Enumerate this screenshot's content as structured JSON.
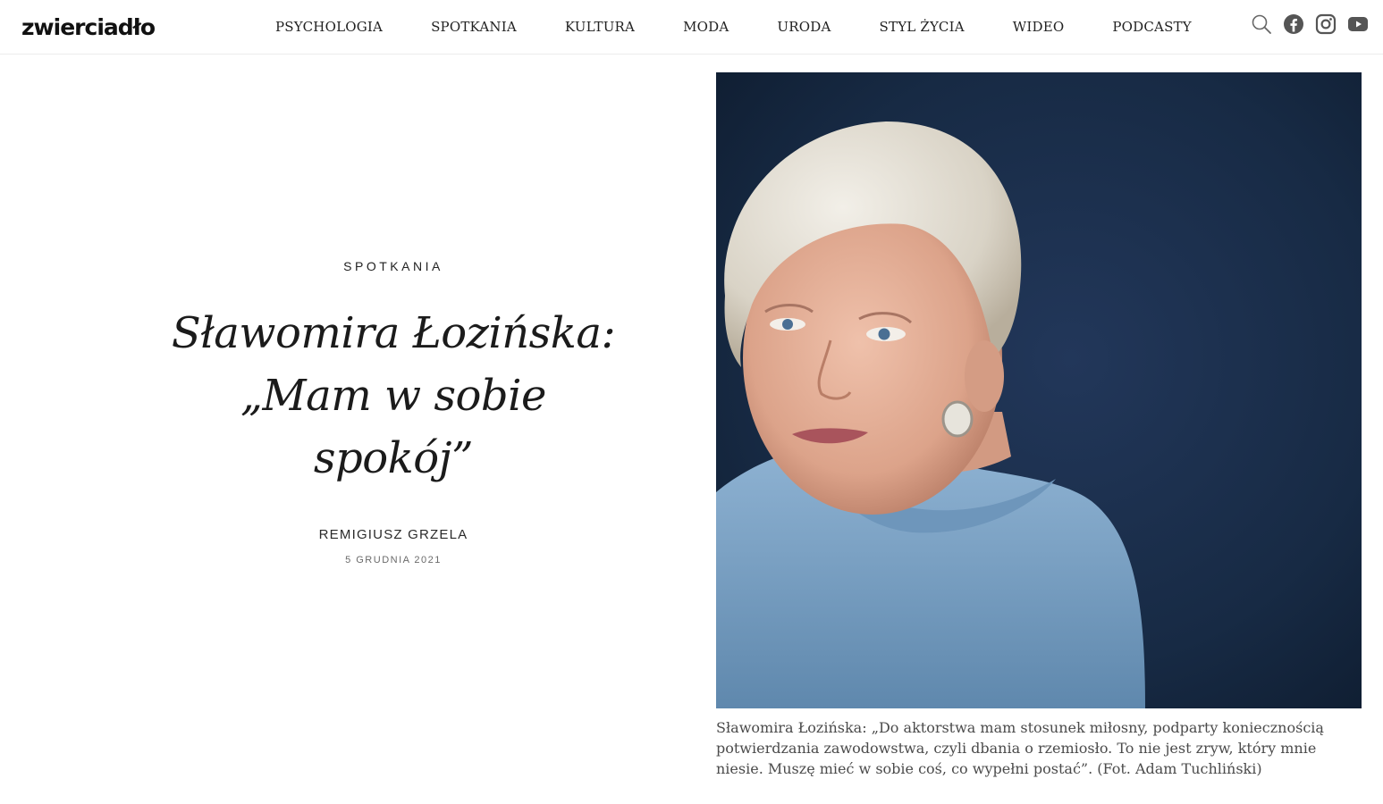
{
  "site": {
    "logo": "zwierciadło"
  },
  "nav": {
    "items": [
      {
        "label": "PSYCHOLOGIA"
      },
      {
        "label": "SPOTKANIA"
      },
      {
        "label": "KULTURA"
      },
      {
        "label": "MODA"
      },
      {
        "label": "URODA"
      },
      {
        "label": "STYL ŻYCIA"
      },
      {
        "label": "WIDEO"
      },
      {
        "label": "PODCASTY"
      }
    ]
  },
  "header_icons": [
    "search-icon",
    "facebook-icon",
    "instagram-icon",
    "youtube-icon"
  ],
  "article": {
    "category": "SPOTKANIA",
    "title_line1": "Sławomira Łozińska:",
    "title_line2": "„Mam w sobie",
    "title_line3": "spokój”",
    "author": "REMIGIUSZ GRZELA",
    "date": "5 GRUDNIA 2021",
    "photo_caption": "Sławomira Łozińska: „Do aktorstwa mam stosunek miłosny, podparty koniecznością potwierdzania zawodowstwa, czyli dbania o rzemiosło. To nie jest zryw, który mnie niesie. Muszę mieć w sobie coś, co wypełni postać”. (Fot. Adam Tuchliński)"
  },
  "colors": {
    "photo_background": "#16263a",
    "sweater": "#7fa6c8",
    "hair": "#e3dfd6",
    "skin": "#e0ad97",
    "text": "#1a1a1a",
    "caption": "#4b4b4b"
  }
}
